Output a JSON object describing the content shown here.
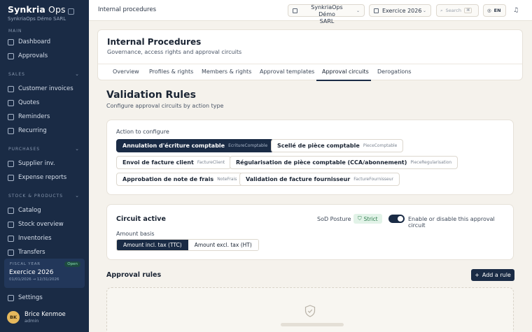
{
  "brand": {
    "name_bold": "Synkria",
    "name_rest": "Ops",
    "subtitle": "SynkriaOps Démo SARL"
  },
  "sidebar": {
    "sections": {
      "main": "MAIN",
      "sales": "SALES",
      "purchases": "PURCHASES",
      "stock": "STOCK & PRODUCTS"
    },
    "items": [
      {
        "label": "Dashboard",
        "icon": "dashboard-icon"
      },
      {
        "label": "Approvals",
        "icon": "check-circle-icon"
      },
      {
        "label": "Customer invoices",
        "icon": "invoice-icon"
      },
      {
        "label": "Quotes",
        "icon": "quote-icon"
      },
      {
        "label": "Reminders",
        "icon": "bell-icon"
      },
      {
        "label": "Recurring",
        "icon": "repeat-icon"
      },
      {
        "label": "Supplier inv.",
        "icon": "supplier-invoice-icon"
      },
      {
        "label": "Expense reports",
        "icon": "receipt-icon"
      },
      {
        "label": "Catalog",
        "icon": "catalog-icon"
      },
      {
        "label": "Stock overview",
        "icon": "warehouse-icon"
      },
      {
        "label": "Inventories",
        "icon": "inventory-icon"
      },
      {
        "label": "Transfers",
        "icon": "transfer-icon"
      }
    ],
    "fiscal": {
      "label": "FISCAL YEAR",
      "badge": "Open",
      "year": "Exercice 2026",
      "range": "01/01/2026 → 12/31/2026"
    },
    "settings": "Settings",
    "user": {
      "initials": "BK",
      "name": "Brice Kenmoe",
      "role": "admin"
    }
  },
  "topbar": {
    "breadcrumb": "Internal procedures",
    "org_line1": "SynkriaOps Démo",
    "org_line2": "SARL",
    "fiscal_year": "Exercice 2026",
    "search_placeholder": "Search",
    "search_kbd": "⌘",
    "lang": "EN"
  },
  "header": {
    "title": "Internal Procedures",
    "subtitle": "Governance, access rights and approval circuits",
    "tabs": [
      "Overview",
      "Profiles & rights",
      "Members & rights",
      "Approval templates",
      "Approval circuits",
      "Derogations"
    ],
    "active_tab": "Approval circuits"
  },
  "main": {
    "title": "Validation Rules",
    "subtitle": "Configure approval circuits by action type",
    "action_label": "Action to configure",
    "actions": [
      {
        "label": "Annulation d'écriture comptable",
        "code": "EcritureComptable",
        "selected": true
      },
      {
        "label": "Scellé de pièce comptable",
        "code": "PieceComptable",
        "selected": false
      },
      {
        "label": "Envoi de facture client",
        "code": "FactureClient",
        "selected": false
      },
      {
        "label": "Régularisation de pièce comptable (CCA/abonnement)",
        "code": "PieceRegularisation",
        "selected": false
      },
      {
        "label": "Approbation de note de frais",
        "code": "NoteFrais",
        "selected": false
      },
      {
        "label": "Validation de facture fournisseur",
        "code": "FactureFournisseur",
        "selected": false
      }
    ],
    "circuit": {
      "title": "Circuit active",
      "sod_label": "SoD Posture",
      "sod_value": "Strict",
      "toggle_on": true,
      "toggle_label": "Enable or disable this approval circuit",
      "basis_label": "Amount basis",
      "basis_options": [
        "Amount incl. tax (TTC)",
        "Amount excl. tax (HT)"
      ],
      "basis_selected": "Amount incl. tax (TTC)"
    },
    "rules": {
      "title": "Approval rules",
      "add_label": "Add a rule",
      "add_icon": "plus-icon",
      "empty_icon": "shield-icon"
    }
  },
  "colors": {
    "navy": "#1a2b45",
    "background": "#f5f2ec",
    "success": "#2b7a4b"
  }
}
